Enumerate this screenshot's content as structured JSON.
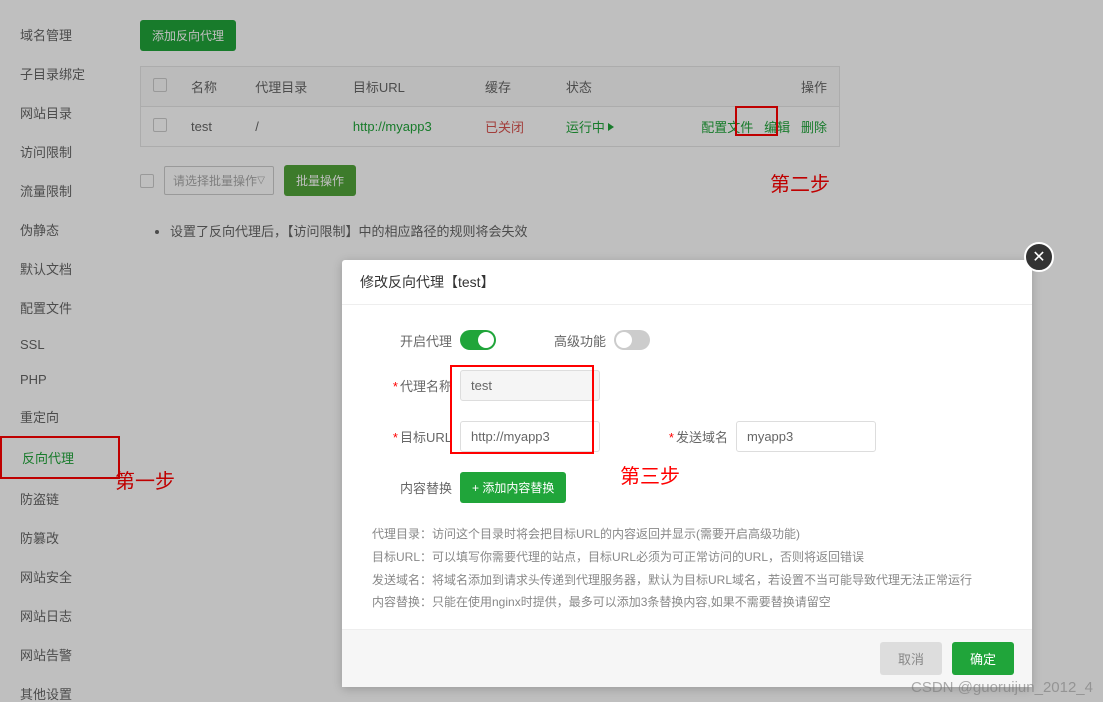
{
  "sidebar": {
    "items": [
      {
        "label": "域名管理"
      },
      {
        "label": "子目录绑定"
      },
      {
        "label": "网站目录"
      },
      {
        "label": "访问限制"
      },
      {
        "label": "流量限制"
      },
      {
        "label": "伪静态"
      },
      {
        "label": "默认文档"
      },
      {
        "label": "配置文件"
      },
      {
        "label": "SSL"
      },
      {
        "label": "PHP"
      },
      {
        "label": "重定向"
      },
      {
        "label": "反向代理"
      },
      {
        "label": "防盗链"
      },
      {
        "label": "防篡改"
      },
      {
        "label": "网站安全"
      },
      {
        "label": "网站日志"
      },
      {
        "label": "网站告警"
      },
      {
        "label": "其他设置"
      }
    ]
  },
  "main": {
    "add_button": "添加反向代理",
    "table": {
      "headers": [
        "名称",
        "代理目录",
        "目标URL",
        "缓存",
        "状态",
        "操作"
      ],
      "rows": [
        {
          "name": "test",
          "dir": "/",
          "url": "http://myapp3",
          "cache": "已关闭",
          "status": "运行中",
          "actions": {
            "config": "配置文件",
            "edit": "编辑",
            "delete": "删除"
          }
        }
      ]
    },
    "batch": {
      "placeholder": "请选择批量操作",
      "button": "批量操作"
    },
    "hint": "设置了反向代理后，【访问限制】中的相应路径的规则将会失效"
  },
  "annotations": {
    "step1": "第一步",
    "step2": "第二步",
    "step3": "第三步"
  },
  "dialog": {
    "title": "修改反向代理【test】",
    "labels": {
      "enable_proxy": "开启代理",
      "advanced": "高级功能",
      "proxy_name": "代理名称",
      "target_url": "目标URL",
      "send_domain": "发送域名",
      "content_replace": "内容替换",
      "add_replace": "+  添加内容替换"
    },
    "values": {
      "proxy_name": "test",
      "target_url": "http://myapp3",
      "send_domain": "myapp3"
    },
    "help": [
      "代理目录：访问这个目录时将会把目标URL的内容返回并显示(需要开启高级功能)",
      "目标URL：可以填写你需要代理的站点，目标URL必须为可正常访问的URL，否则将返回错误",
      "发送域名：将域名添加到请求头传递到代理服务器，默认为目标URL域名，若设置不当可能导致代理无法正常运行",
      "内容替换：只能在使用nginx时提供，最多可以添加3条替换内容,如果不需要替换请留空"
    ],
    "buttons": {
      "cancel": "取消",
      "confirm": "确定"
    }
  },
  "watermark": "CSDN @guoruijun_2012_4"
}
